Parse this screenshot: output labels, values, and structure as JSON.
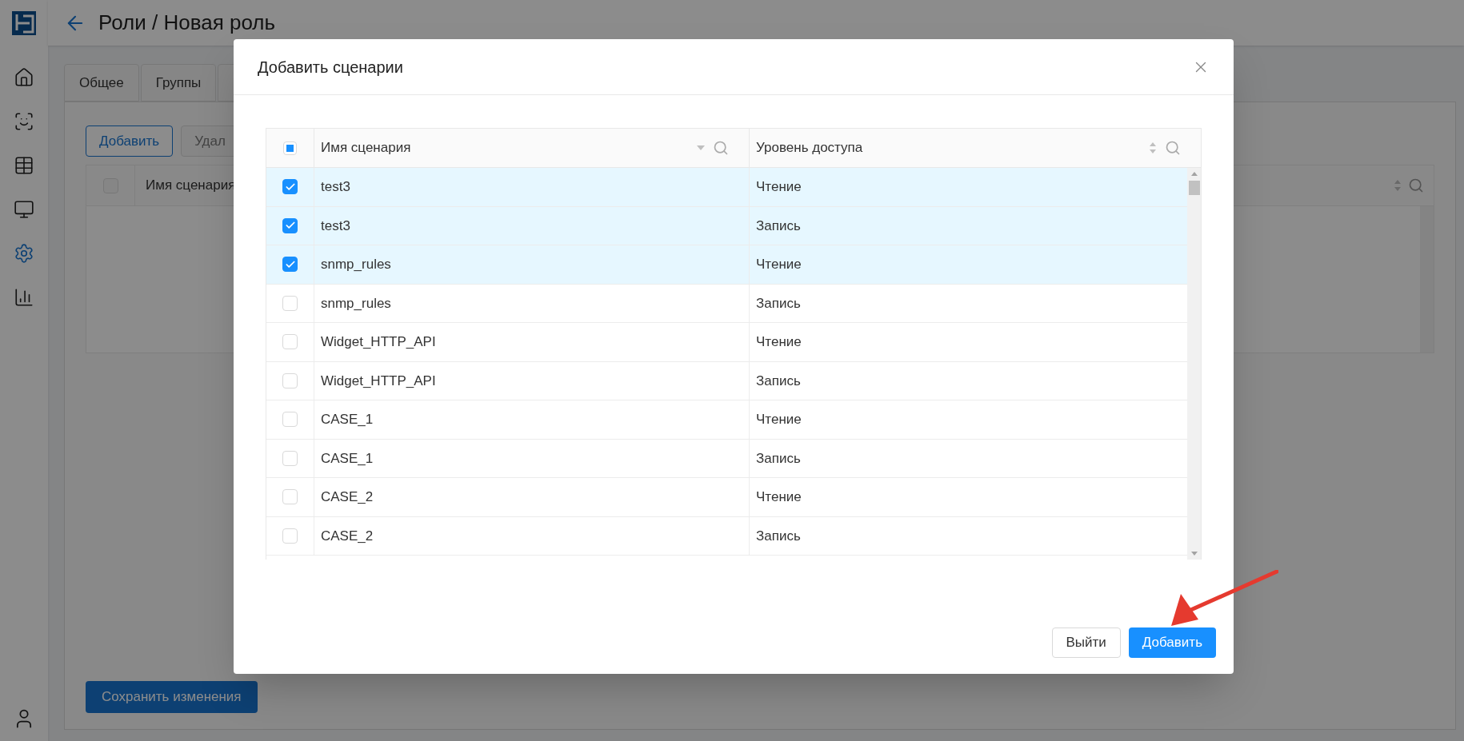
{
  "sidebar": {
    "items": [
      {
        "kind": "home",
        "selected": false
      },
      {
        "kind": "face",
        "selected": false
      },
      {
        "kind": "table",
        "selected": false
      },
      {
        "kind": "monitor",
        "selected": false
      },
      {
        "kind": "settings",
        "selected": true
      },
      {
        "kind": "chart",
        "selected": false
      }
    ]
  },
  "header": {
    "title": "Роли / Новая роль"
  },
  "page": {
    "tabs": [
      "Общее",
      "Группы"
    ],
    "toolbar": [
      "Добавить",
      "Удал"
    ],
    "table": {
      "select_all": {
        "checked": false
      },
      "columns": [
        "Имя сценария"
      ]
    },
    "save_button": "Сохранить изменения"
  },
  "dialog": {
    "title": "Добавить сценарии",
    "select_all": {
      "indeterminate": true
    },
    "columns": [
      {
        "label": "Имя сценария",
        "kind": "filter"
      },
      {
        "label": "Уровень доступа",
        "kind": "sort"
      }
    ],
    "rows": [
      {
        "name": "test3",
        "access": "Чтение",
        "selected": true
      },
      {
        "name": "test3",
        "access": "Запись",
        "selected": true
      },
      {
        "name": "snmp_rules",
        "access": "Чтение",
        "selected": true
      },
      {
        "name": "snmp_rules",
        "access": "Запись",
        "selected": false
      },
      {
        "name": "Widget_HTTP_API",
        "access": "Чтение",
        "selected": false
      },
      {
        "name": "Widget_HTTP_API",
        "access": "Запись",
        "selected": false
      },
      {
        "name": "CASE_1",
        "access": "Чтение",
        "selected": false
      },
      {
        "name": "CASE_1",
        "access": "Запись",
        "selected": false
      },
      {
        "name": "CASE_2",
        "access": "Чтение",
        "selected": false
      },
      {
        "name": "CASE_2",
        "access": "Запись",
        "selected": false
      }
    ],
    "buttons": [
      {
        "label": "Выйти",
        "kind": "secondary"
      },
      {
        "label": "Добавить",
        "kind": "primary"
      }
    ]
  }
}
